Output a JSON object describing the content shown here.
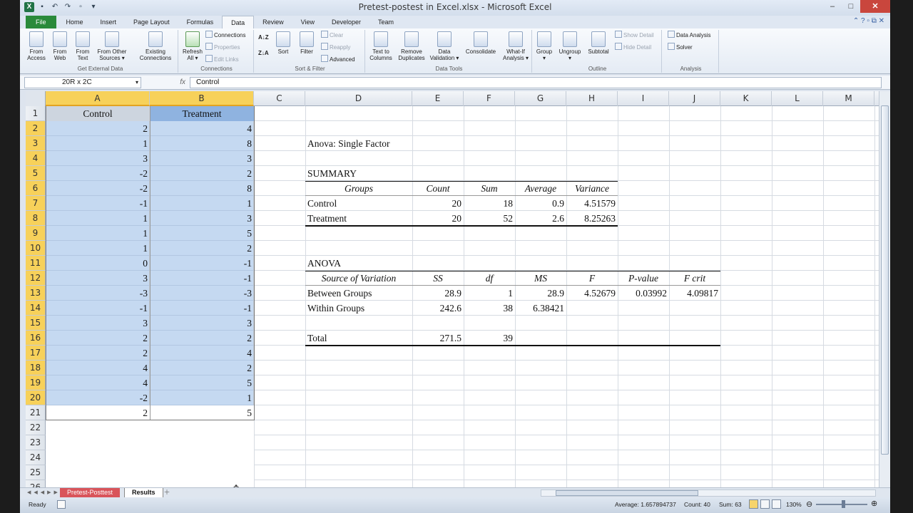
{
  "window": {
    "title": "Pretest-postest in Excel.xlsx - Microsoft Excel"
  },
  "ribbon": {
    "tabs": [
      "File",
      "Home",
      "Insert",
      "Page Layout",
      "Formulas",
      "Data",
      "Review",
      "View",
      "Developer",
      "Team"
    ],
    "active_tab": "Data",
    "groups": {
      "get_external_data": {
        "label": "Get External Data",
        "buttons": [
          "From\nAccess",
          "From\nWeb",
          "From\nText",
          "From Other\nSources ▾",
          "Existing\nConnections"
        ]
      },
      "connections": {
        "label": "Connections",
        "refresh": "Refresh\nAll ▾",
        "items": [
          "Connections",
          "Properties",
          "Edit Links"
        ]
      },
      "sort_filter": {
        "label": "Sort & Filter",
        "sort": "Sort",
        "filter": "Filter",
        "items": [
          "Clear",
          "Reapply",
          "Advanced"
        ]
      },
      "data_tools": {
        "label": "Data Tools",
        "buttons": [
          "Text to\nColumns",
          "Remove\nDuplicates",
          "Data\nValidation ▾",
          "Consolidate",
          "What-If\nAnalysis ▾"
        ]
      },
      "outline": {
        "label": "Outline",
        "buttons": [
          "Group\n▾",
          "Ungroup\n▾",
          "Subtotal"
        ],
        "items": [
          "Show Detail",
          "Hide Detail"
        ]
      },
      "analysis": {
        "label": "Analysis",
        "items": [
          "Data Analysis",
          "Solver"
        ]
      }
    }
  },
  "formula_bar": {
    "name_box": "20R x 2C",
    "fx": "fx",
    "content": "Control"
  },
  "sheet": {
    "columns": [
      "A",
      "B",
      "C",
      "D",
      "E",
      "F",
      "G",
      "H",
      "I",
      "J",
      "K",
      "L",
      "M"
    ],
    "rows": [
      "1",
      "2",
      "3",
      "4",
      "5",
      "6",
      "7",
      "8",
      "9",
      "10",
      "11",
      "12",
      "13",
      "14",
      "15",
      "16",
      "17",
      "18",
      "19",
      "20",
      "21",
      "22",
      "23",
      "24",
      "25",
      "26"
    ],
    "header_a": "Control",
    "header_b": "Treatment",
    "col_a": [
      "2",
      "1",
      "3",
      "-2",
      "-2",
      "-1",
      "1",
      "1",
      "1",
      "0",
      "3",
      "-3",
      "-1",
      "3",
      "2",
      "2",
      "4",
      "4",
      "-2",
      "2"
    ],
    "col_b": [
      "4",
      "8",
      "3",
      "2",
      "8",
      "1",
      "3",
      "5",
      "2",
      "-1",
      "-1",
      "-3",
      "-1",
      "3",
      "2",
      "4",
      "2",
      "5",
      "1",
      "5"
    ],
    "anova": {
      "title": "Anova: Single Factor",
      "summary_label": "SUMMARY",
      "summary_headers": [
        "Groups",
        "Count",
        "Sum",
        "Average",
        "Variance"
      ],
      "summary_rows": [
        [
          "Control",
          "20",
          "18",
          "0.9",
          "4.51579"
        ],
        [
          "Treatment",
          "20",
          "52",
          "2.6",
          "8.25263"
        ]
      ],
      "anova_label": "ANOVA",
      "anova_headers": [
        "Source of Variation",
        "SS",
        "df",
        "MS",
        "F",
        "P-value",
        "F crit"
      ],
      "anova_rows": [
        [
          "Between Groups",
          "28.9",
          "1",
          "28.9",
          "4.52679",
          "0.03992",
          "4.09817"
        ],
        [
          "Within Groups",
          "242.6",
          "38",
          "6.38421",
          "",
          "",
          ""
        ]
      ],
      "total_row": [
        "Total",
        "271.5",
        "39"
      ]
    }
  },
  "sheet_tabs": {
    "tabs": [
      "Pretest-Posttest",
      "Results"
    ],
    "active": "Results"
  },
  "status_bar": {
    "ready": "Ready",
    "average": "Average: 1.657894737",
    "count": "Count: 40",
    "sum": "Sum: 63",
    "zoom": "130%"
  },
  "colors": {
    "selection": "#c5d9f1",
    "header_highlight": "#f7d15a",
    "file_tab": "#2a8a3a"
  }
}
